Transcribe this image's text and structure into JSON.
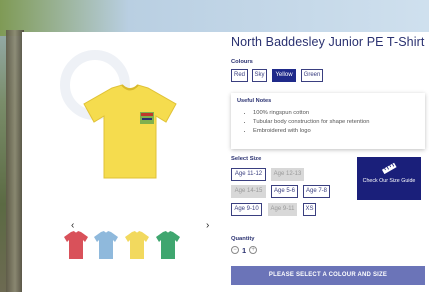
{
  "product": {
    "title": "North Baddesley Junior PE T-Shirt",
    "colours_label": "Colours",
    "colours": [
      {
        "label": "Red",
        "selected": false
      },
      {
        "label": "Sky",
        "selected": false
      },
      {
        "label": "Yellow",
        "selected": true
      },
      {
        "label": "Green",
        "selected": false
      }
    ],
    "useful_notes": {
      "title": "Useful Notes",
      "items": [
        "100% ringspun cotton",
        "Tubular body construction for shape retention",
        "Embroidered with logo"
      ]
    },
    "size_label": "Select Size",
    "sizes": [
      {
        "label": "Age 11-12",
        "available": true
      },
      {
        "label": "Age 12-13",
        "available": false
      },
      {
        "label": "Age 14-15",
        "available": false
      },
      {
        "label": "Age 5-6",
        "available": true
      },
      {
        "label": "Age 7-8",
        "available": true
      },
      {
        "label": "Age 9-10",
        "available": true
      },
      {
        "label": "Age 9-11",
        "available": false
      },
      {
        "label": "XS",
        "available": true
      }
    ],
    "size_guide_label": "Check Our Size Guide",
    "quantity_label": "Quantity",
    "quantity": "1",
    "cta_label": "PLEASE SELECT A COLOUR AND SIZE"
  },
  "gallery": {
    "prev_icon": "‹",
    "next_icon": "›",
    "thumb_colors": [
      "#d9515a",
      "#8fb9dc",
      "#f2d95e",
      "#3fa66f"
    ],
    "main_color": "#f5dc4e"
  },
  "theme": {
    "accent": "#1f2a8a",
    "cta": "#6b74b8",
    "title": "#2a3170"
  }
}
